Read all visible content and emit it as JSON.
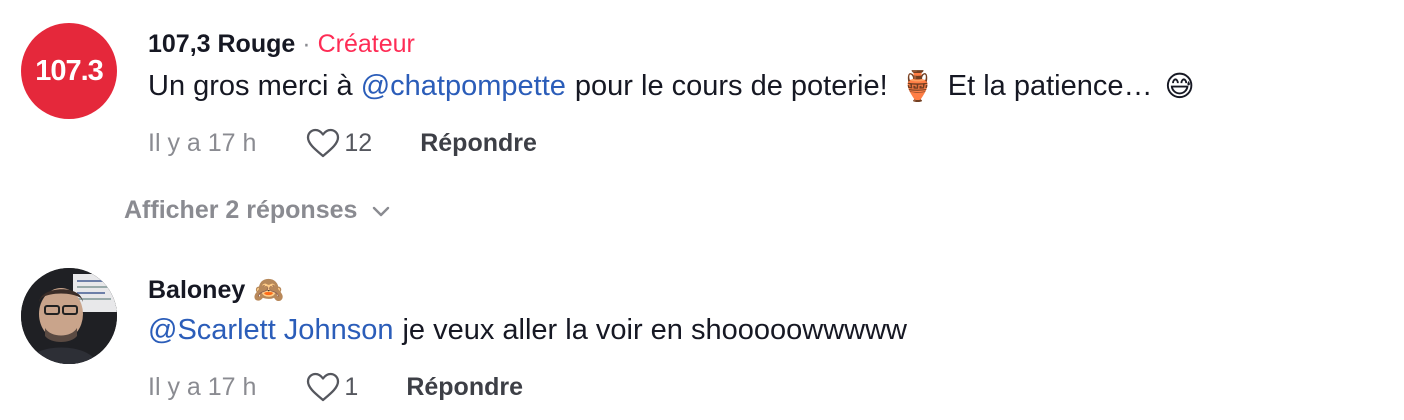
{
  "comments": [
    {
      "avatar_text": "107.3",
      "author": "107,3 Rouge",
      "separator": "·",
      "badge": "Créateur",
      "mention": "@chatpompette",
      "text_part1": "pour le cours de poterie!",
      "emoji1": "🏺",
      "text_part2": "Et la patience…",
      "emoji2": "😅",
      "time": "Il y a 17 h",
      "likes": "12",
      "reply_label": "Répondre",
      "view_replies": "Afficher 2 réponses",
      "avatar_color": "#e5283b"
    },
    {
      "author": "Baloney",
      "author_emoji": "🙈",
      "mention": "@Scarlett Johnson",
      "text": "je veux aller la voir en shooooowwwww",
      "time": "Il y a 17 h",
      "likes": "1",
      "reply_label": "Répondre"
    }
  ],
  "colors": {
    "badge": "#fe2c55",
    "mention": "#2b5db9",
    "muted": "#8a8b91"
  }
}
